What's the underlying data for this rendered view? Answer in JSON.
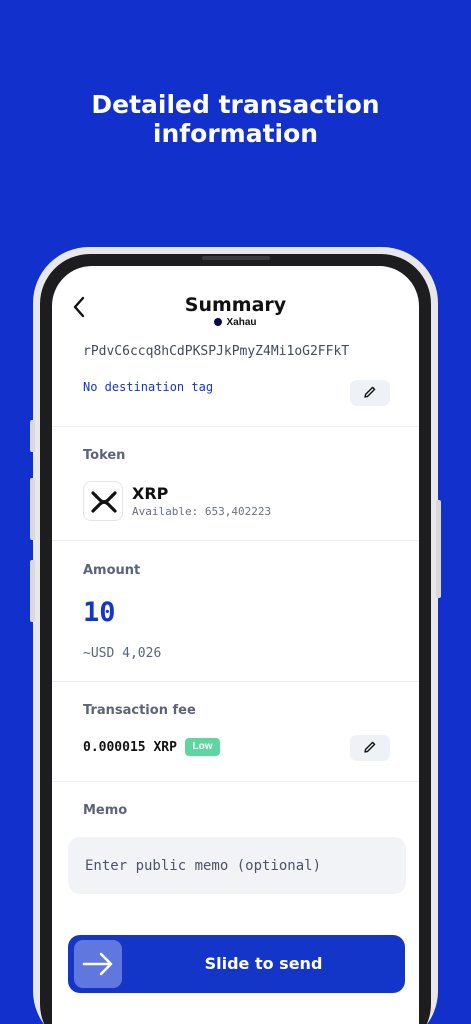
{
  "headline": {
    "line1": "Detailed transaction",
    "line2": "information"
  },
  "header": {
    "back_icon": "chevron-left-icon",
    "title": "Summary",
    "network": "Xahau"
  },
  "destination": {
    "address": "rPdvC6ccq8hCdPKSPJkPmyZ4Mi1oG2FFkT",
    "tag_text": "No destination tag",
    "edit_icon": "pencil-icon"
  },
  "token": {
    "label": "Token",
    "name": "XRP",
    "available": "Available: 653,402223",
    "logo_icon": "xrp-logo-icon"
  },
  "amount": {
    "label": "Amount",
    "value": "10",
    "fiat": "~USD 4,026"
  },
  "fee": {
    "label": "Transaction fee",
    "value": "0.000015 XRP",
    "level": "Low",
    "edit_icon": "pencil-icon"
  },
  "memo": {
    "label": "Memo",
    "placeholder": "Enter public memo (optional)"
  },
  "send": {
    "label": "Slide to send",
    "arrow_icon": "arrow-right-icon"
  },
  "colors": {
    "background": "#1130cc",
    "accent": "#1436c8",
    "badge_low": "#5fd6a0"
  }
}
